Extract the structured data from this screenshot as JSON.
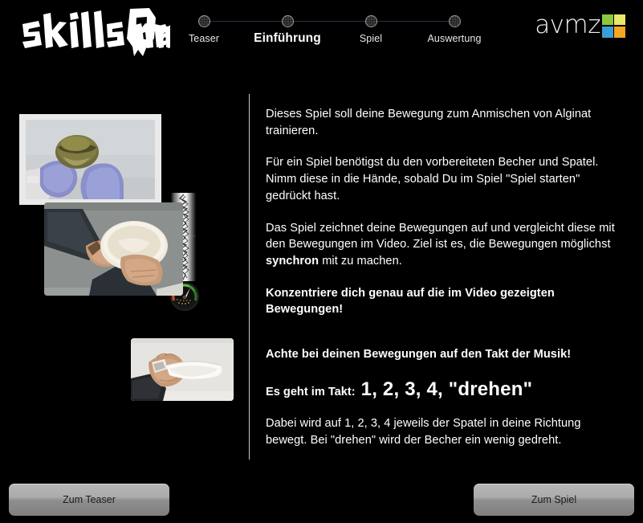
{
  "header": {
    "brand": "SkillsOmat",
    "brand_parts": {
      "left": "Skills",
      "middle": "O",
      "right": "mat"
    },
    "partner_logo": {
      "word": "avmz",
      "tiles": [
        {
          "name": "tile-top-left",
          "color": "#8dc63f"
        },
        {
          "name": "tile-top-right",
          "color": "#e8e86a"
        },
        {
          "name": "tile-bottom-left",
          "color": "#3b9fd6"
        },
        {
          "name": "tile-bottom-right",
          "color": "#f5a623"
        }
      ]
    },
    "stepper": {
      "active_index": 1,
      "steps": [
        {
          "label": "Teaser"
        },
        {
          "label": "Einführung"
        },
        {
          "label": "Spiel"
        },
        {
          "label": "Auswertung"
        }
      ]
    }
  },
  "media": {
    "video_thumbnail": {
      "name": "video-mixing-alginate",
      "alt": "Hände mit blauen Handschuhen mischen Alginat in einem Becher"
    },
    "waveform": {
      "name": "motion-waveform-strip"
    },
    "gauge": {
      "name": "speed-gauge"
    },
    "photo_bowl": {
      "name": "photo-holding-bowl",
      "alt": "Hand hält den vorbereiteten Becher"
    },
    "photo_spatula": {
      "name": "photo-holding-spatula",
      "alt": "Hand hält den Spatel"
    }
  },
  "content": {
    "p1": "Dieses Spiel soll deine Bewegung zum Anmischen von Alginat trainieren.",
    "p2": "Für ein Spiel benötigst du den vorbereiteten Becher und  Spatel. Nimm diese in die Hände, sobald Du im Spiel \"Spiel starten\" gedrückt hast.",
    "p3_before": "Das Spiel zeichnet deine Bewegungen auf und vergleicht diese mit den Bewegungen im Video. Ziel ist es, die Bewegungen möglichst ",
    "p3_bold": "synchron",
    "p3_after": " mit zu machen.",
    "p4": "Konzentriere dich genau auf die im Video gezeigten Bewegungen!",
    "p5": "Achte bei deinen Bewegungen auf den Takt der Musik!",
    "takt_prefix": "Es geht im Takt:",
    "takt_value": "1, 2, 3, 4, \"drehen\"",
    "p6": "Dabei wird auf 1, 2, 3, 4 jeweils der Spatel in deine Richtung bewegt. Bei \"drehen\" wird der Becher ein wenig gedreht."
  },
  "footer": {
    "back_button": "Zum Teaser",
    "next_button": "Zum Spiel"
  }
}
